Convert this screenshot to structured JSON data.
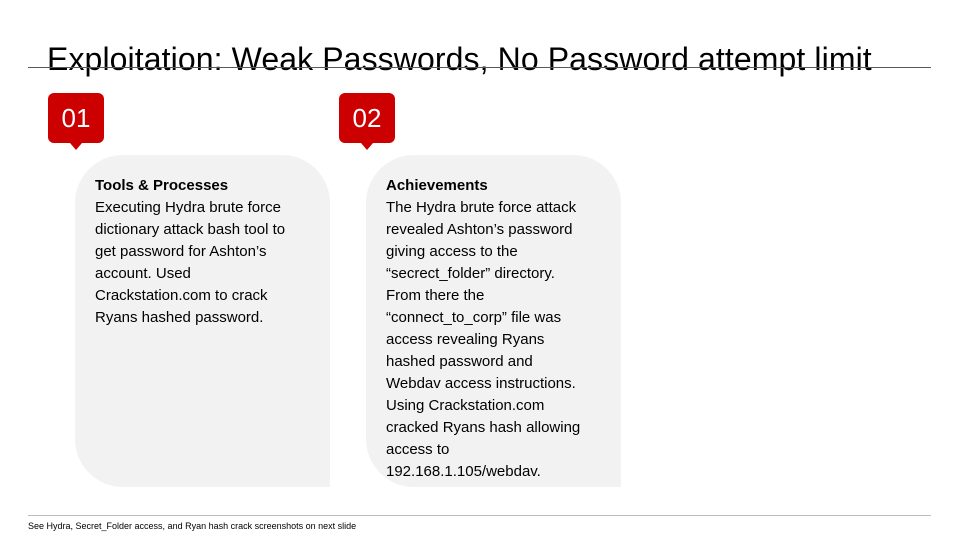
{
  "title": "Exploitation: Weak Passwords, No Password attempt limit",
  "accent_color": "#cc0000",
  "card_background": "#f2f2f2",
  "steps": [
    {
      "number": "01",
      "heading": "Tools & Processes",
      "body": "Executing Hydra brute force\ndictionary attack bash tool to\nget password for Ashton’s\naccount. Used\nCrackstation.com to crack\nRyans hashed password."
    },
    {
      "number": "02",
      "heading": "Achievements",
      "body": "The Hydra brute force attack\nrevealed Ashton’s password\ngiving access to the\n“secrect_folder” directory.\nFrom there the\n“connect_to_corp” file was\naccess revealing Ryans\nhashed password and\nWebdav access instructions.\nUsing Crackstation.com\ncracked Ryans hash allowing\naccess to\n192.168.1.105/webdav."
    }
  ],
  "footnote": "See Hydra, Secret_Folder access, and Ryan hash crack screenshots on next slide"
}
